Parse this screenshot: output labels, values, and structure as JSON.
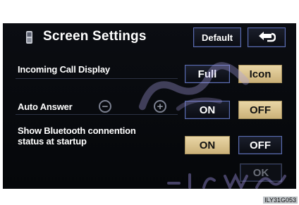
{
  "header": {
    "title": "Screen Settings",
    "default_label": "Default",
    "back_icon": "return-arrow-icon"
  },
  "rows": {
    "incoming_call": {
      "label": "Incoming Call Display",
      "option_a": "Full",
      "option_b": "Icon",
      "selected": "Icon"
    },
    "auto_answer": {
      "label": "Auto Answer",
      "minus_icon": "minus-icon",
      "plus_icon": "plus-icon",
      "option_a": "ON",
      "option_b": "OFF",
      "selected": "OFF"
    },
    "bluetooth": {
      "label_line1": "Show Bluetooth connention",
      "label_line2": "status at startup",
      "option_a": "ON",
      "option_b": "OFF",
      "selected": "ON"
    }
  },
  "footer": {
    "ok_label": "OK"
  },
  "image_code": "ILY31G053",
  "colors": {
    "selected": "#d9c391",
    "border": "#5d6eb0",
    "background": "#07090d"
  }
}
